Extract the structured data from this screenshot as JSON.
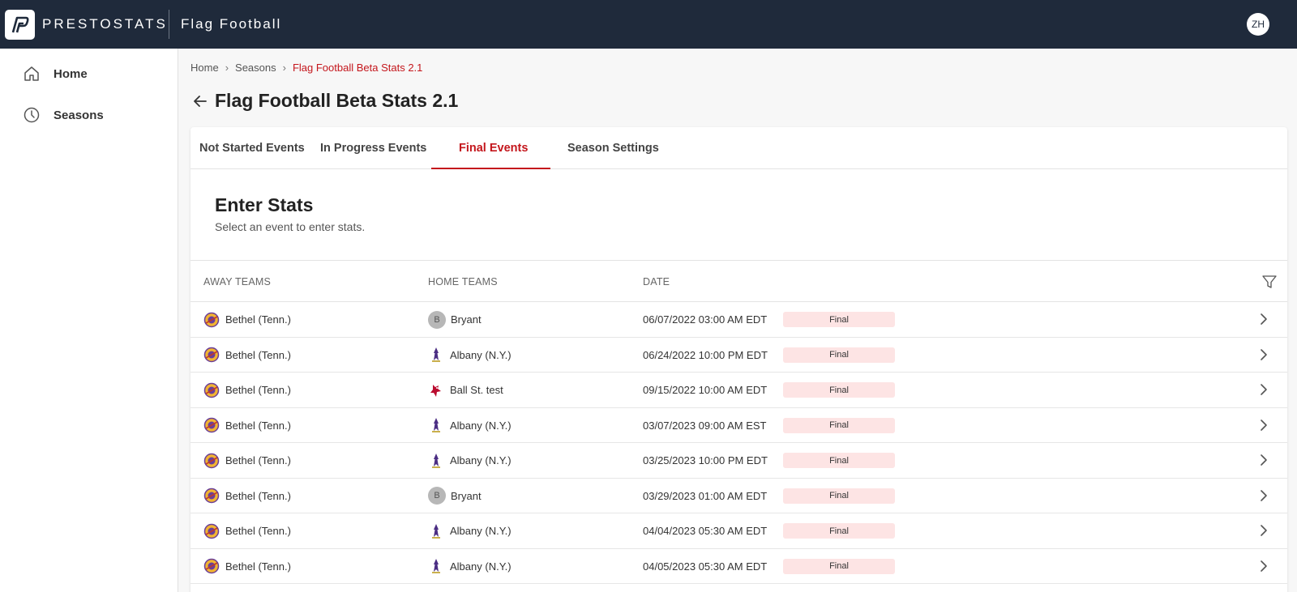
{
  "header": {
    "brand": "PRESTOSTATS",
    "sport": "Flag Football",
    "user_initials": "ZH"
  },
  "sidebar": {
    "items": [
      {
        "label": "Home",
        "icon": "home-icon"
      },
      {
        "label": "Seasons",
        "icon": "clock-icon"
      }
    ]
  },
  "breadcrumb": {
    "items": [
      "Home",
      "Seasons"
    ],
    "current": "Flag Football Beta Stats 2.1"
  },
  "page": {
    "title": "Flag Football Beta Stats 2.1"
  },
  "tabs": [
    {
      "label": "Not Started Events",
      "active": false
    },
    {
      "label": "In Progress Events",
      "active": false
    },
    {
      "label": "Final Events",
      "active": true
    },
    {
      "label": "Season Settings",
      "active": false
    }
  ],
  "section": {
    "title": "Enter Stats",
    "subtitle": "Select an event to enter stats."
  },
  "table": {
    "columns": [
      "AWAY TEAMS",
      "HOME TEAMS",
      "DATE"
    ],
    "rows": [
      {
        "away": "Bethel (Tenn.)",
        "home": "Bryant",
        "home_logo": "b-letter-icon",
        "date": "06/07/2022 03:00 AM EDT",
        "status": "Final"
      },
      {
        "away": "Bethel (Tenn.)",
        "home": "Albany (N.Y.)",
        "home_logo": "albany-logo-icon",
        "date": "06/24/2022 10:00 PM EDT",
        "status": "Final"
      },
      {
        "away": "Bethel (Tenn.)",
        "home": "Ball St. test",
        "home_logo": "ball-state-logo-icon",
        "date": "09/15/2022 10:00 AM EDT",
        "status": "Final"
      },
      {
        "away": "Bethel (Tenn.)",
        "home": "Albany (N.Y.)",
        "home_logo": "albany-logo-icon",
        "date": "03/07/2023 09:00 AM EST",
        "status": "Final"
      },
      {
        "away": "Bethel (Tenn.)",
        "home": "Albany (N.Y.)",
        "home_logo": "albany-logo-icon",
        "date": "03/25/2023 10:00 PM EDT",
        "status": "Final"
      },
      {
        "away": "Bethel (Tenn.)",
        "home": "Bryant",
        "home_logo": "b-letter-icon",
        "date": "03/29/2023 01:00 AM EDT",
        "status": "Final"
      },
      {
        "away": "Bethel (Tenn.)",
        "home": "Albany (N.Y.)",
        "home_logo": "albany-logo-icon",
        "date": "04/04/2023 05:30 AM EDT",
        "status": "Final"
      },
      {
        "away": "Bethel (Tenn.)",
        "home": "Albany (N.Y.)",
        "home_logo": "albany-logo-icon",
        "date": "04/05/2023 05:30 AM EDT",
        "status": "Final"
      }
    ]
  },
  "colors": {
    "topbar": "#1f2a3b",
    "accent": "#c4161c",
    "status_bg": "#fde4e4"
  }
}
